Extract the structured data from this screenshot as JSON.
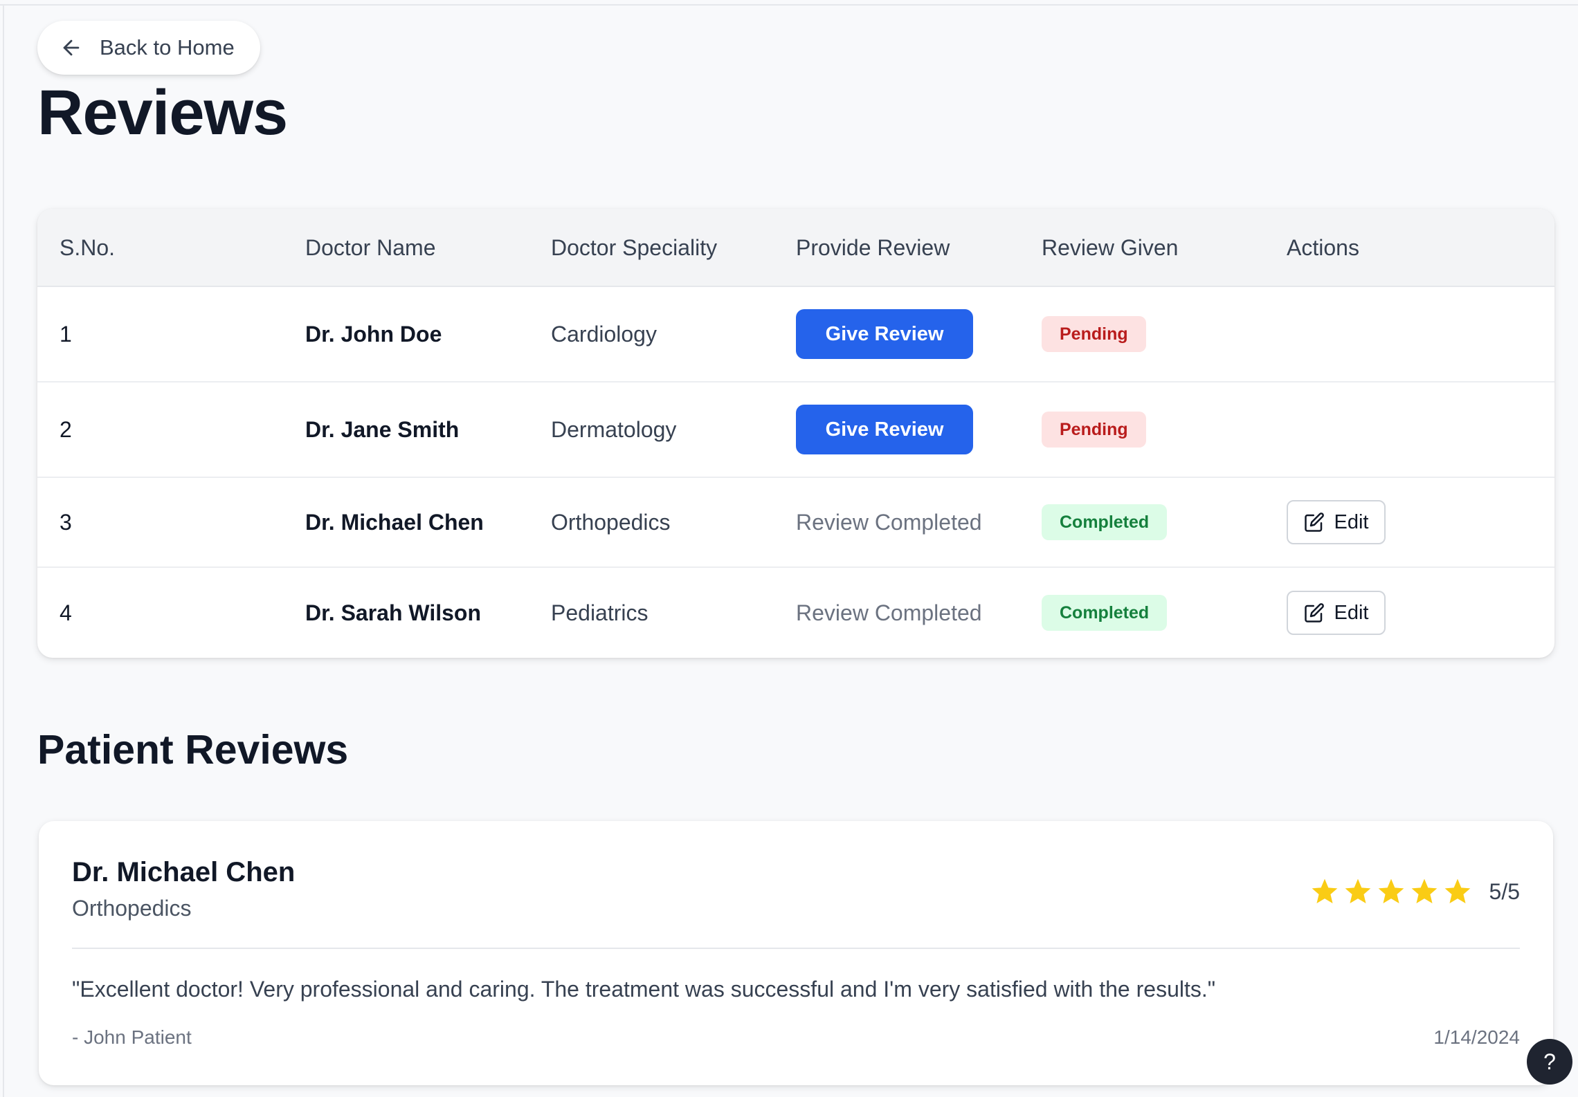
{
  "nav": {
    "back_label": "Back to Home"
  },
  "page": {
    "title": "Reviews",
    "section_title": "Patient Reviews"
  },
  "table": {
    "headers": [
      "S.No.",
      "Doctor Name",
      "Doctor Speciality",
      "Provide Review",
      "Review Given",
      "Actions"
    ],
    "rows": [
      {
        "sno": "1",
        "doctor": "Dr. John Doe",
        "speciality": "Cardiology",
        "provide": "Give Review",
        "status": "Pending",
        "action": ""
      },
      {
        "sno": "2",
        "doctor": "Dr. Jane Smith",
        "speciality": "Dermatology",
        "provide": "Give Review",
        "status": "Pending",
        "action": ""
      },
      {
        "sno": "3",
        "doctor": "Dr. Michael Chen",
        "speciality": "Orthopedics",
        "provide": "Review Completed",
        "status": "Completed",
        "action": "Edit"
      },
      {
        "sno": "4",
        "doctor": "Dr. Sarah Wilson",
        "speciality": "Pediatrics",
        "provide": "Review Completed",
        "status": "Completed",
        "action": "Edit"
      }
    ]
  },
  "review": {
    "doctor": "Dr. Michael Chen",
    "speciality": "Orthopedics",
    "rating": 5,
    "rating_max": 5,
    "rating_label": "5/5",
    "text": "\"Excellent doctor! Very professional and caring. The treatment was successful and I'm very satisfied with the results.\"",
    "author": "- John Patient",
    "date": "1/14/2024"
  },
  "help": {
    "label": "?"
  },
  "colors": {
    "primary": "#2563eb",
    "pending_bg": "#fde2e2",
    "pending_text": "#b91c1c",
    "completed_bg": "#dcfce7",
    "completed_text": "#15803d",
    "star": "#facc15"
  },
  "icons": {
    "back": "arrow-left-icon",
    "edit": "edit-square-icon",
    "star": "star-icon",
    "help": "help-icon"
  }
}
